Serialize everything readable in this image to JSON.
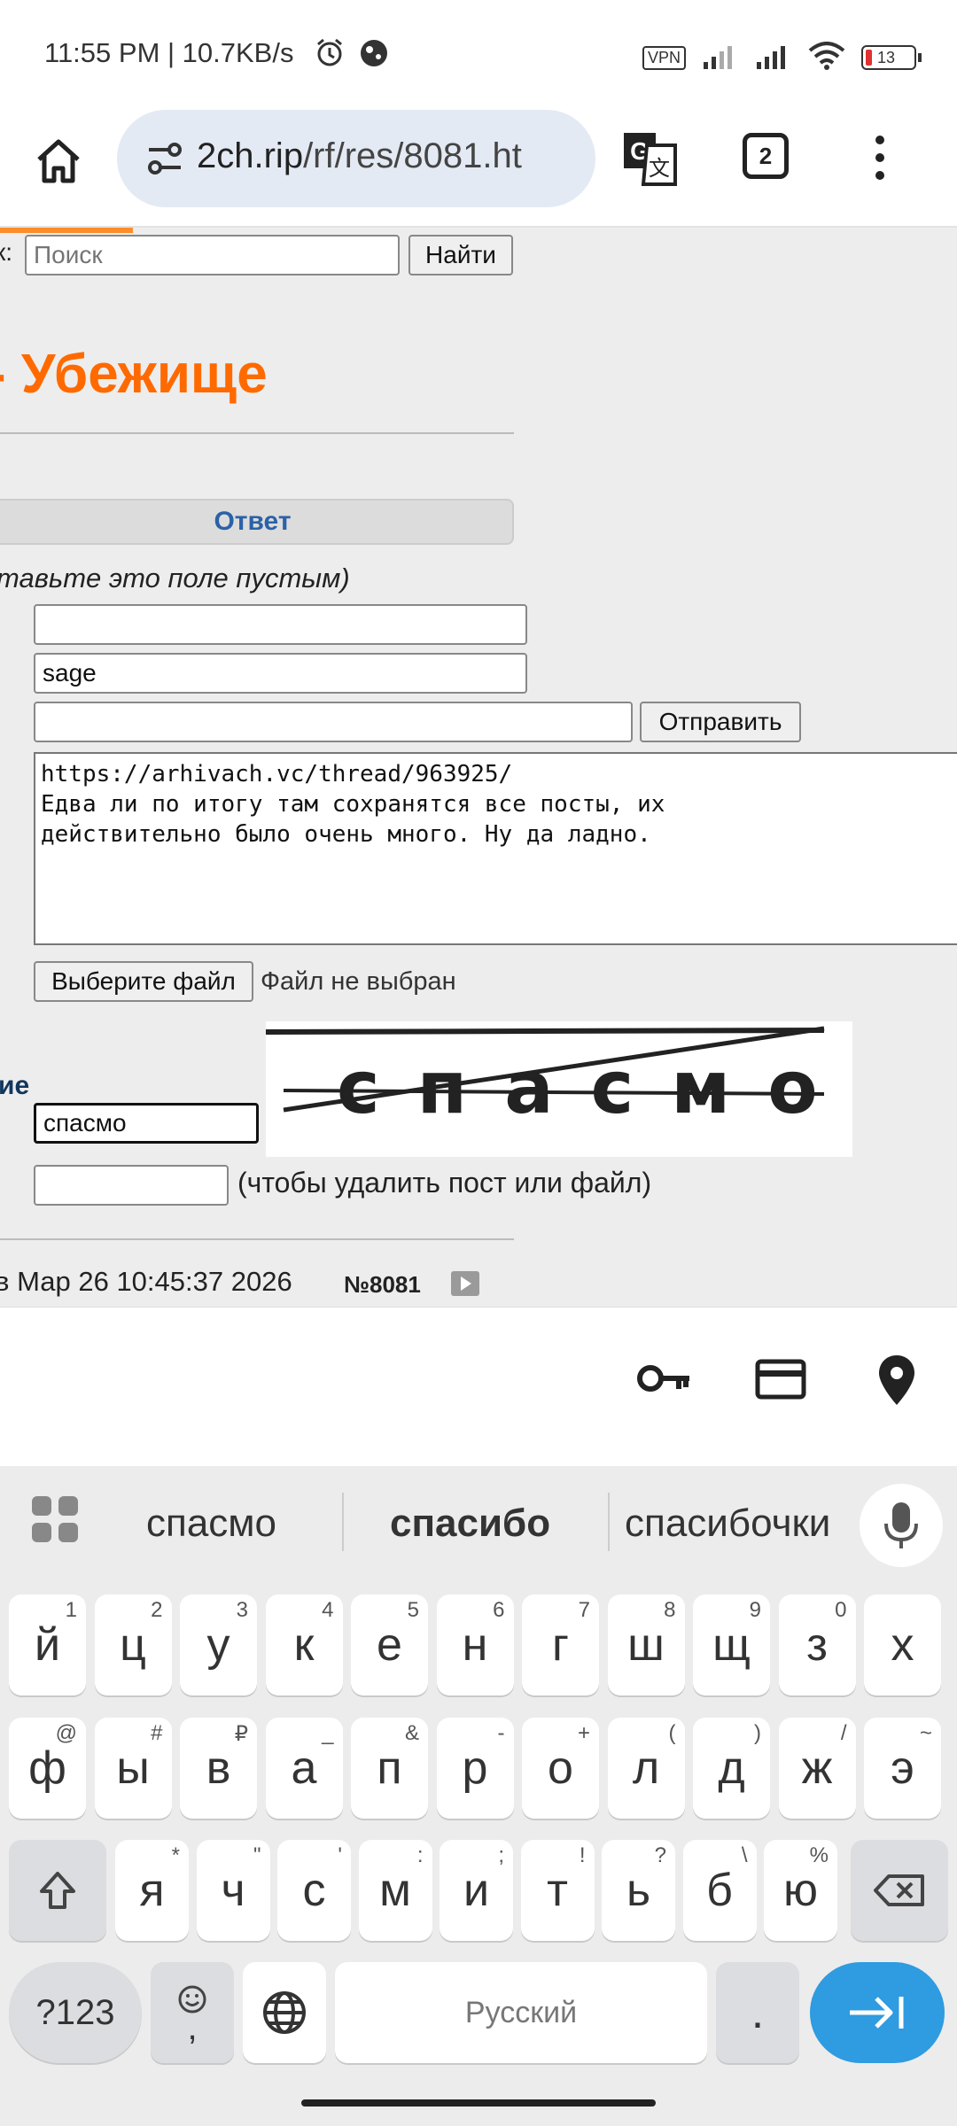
{
  "status": {
    "time": "11:55 PM | 10.7KB/s",
    "vpn": "VPN",
    "battery": "13"
  },
  "browser": {
    "url_host": "2ch.rip",
    "url_path": "/rf/res/8081.ht",
    "tab_count": "2"
  },
  "page": {
    "search_label": "к:",
    "search_placeholder": "Поиск",
    "search_button": "Найти",
    "board_title": "- Убежище",
    "reply_bar": "Ответ",
    "leave_empty_note": "тавьте это поле пустым)",
    "email_value": "sage",
    "submit_button": "Отправить",
    "message_text": "https://arhivach.vc/thread/963925/\nЕдва ли по итогу там сохранятся все посты, их\nдействительно было очень много. Ну да ладно.",
    "file_button": "Выберите файл",
    "file_status": "Файл не выбран",
    "captcha_label": "ие",
    "captcha_value": "спасмо",
    "captcha_image_text": "спасмо",
    "delete_note": "(чтобы удалить пост или файл)",
    "post_date": "в Мар 26 10:45:37 2026",
    "post_number": "№8081"
  },
  "keyboard": {
    "suggestions": [
      "спасмо",
      "спасибо",
      "спасибочки"
    ],
    "row1": [
      {
        "k": "й",
        "h": "1"
      },
      {
        "k": "ц",
        "h": "2"
      },
      {
        "k": "у",
        "h": "3"
      },
      {
        "k": "к",
        "h": "4"
      },
      {
        "k": "е",
        "h": "5"
      },
      {
        "k": "н",
        "h": "6"
      },
      {
        "k": "г",
        "h": "7"
      },
      {
        "k": "ш",
        "h": "8"
      },
      {
        "k": "щ",
        "h": "9"
      },
      {
        "k": "з",
        "h": "0"
      },
      {
        "k": "х",
        "h": ""
      }
    ],
    "row2": [
      {
        "k": "ф",
        "h": "@"
      },
      {
        "k": "ы",
        "h": "#"
      },
      {
        "k": "в",
        "h": "₽"
      },
      {
        "k": "а",
        "h": "_"
      },
      {
        "k": "п",
        "h": "&"
      },
      {
        "k": "р",
        "h": "-"
      },
      {
        "k": "о",
        "h": "+"
      },
      {
        "k": "л",
        "h": "("
      },
      {
        "k": "д",
        "h": ")"
      },
      {
        "k": "ж",
        "h": "/"
      },
      {
        "k": "э",
        "h": "~"
      }
    ],
    "row3": [
      {
        "k": "я",
        "h": "*"
      },
      {
        "k": "ч",
        "h": "\""
      },
      {
        "k": "с",
        "h": "'"
      },
      {
        "k": "м",
        "h": ":"
      },
      {
        "k": "и",
        "h": ";"
      },
      {
        "k": "т",
        "h": "!"
      },
      {
        "k": "ь",
        "h": "?"
      },
      {
        "k": "б",
        "h": "\\"
      },
      {
        "k": "ю",
        "h": "%"
      }
    ],
    "symbols_key": "?123",
    "comma_key": ",",
    "space_label": "Русский",
    "period_key": "."
  },
  "colors": {
    "accent_orange": "#ff6a00",
    "reply_blue": "#2a62a7",
    "enter_blue": "#2f9be0"
  }
}
